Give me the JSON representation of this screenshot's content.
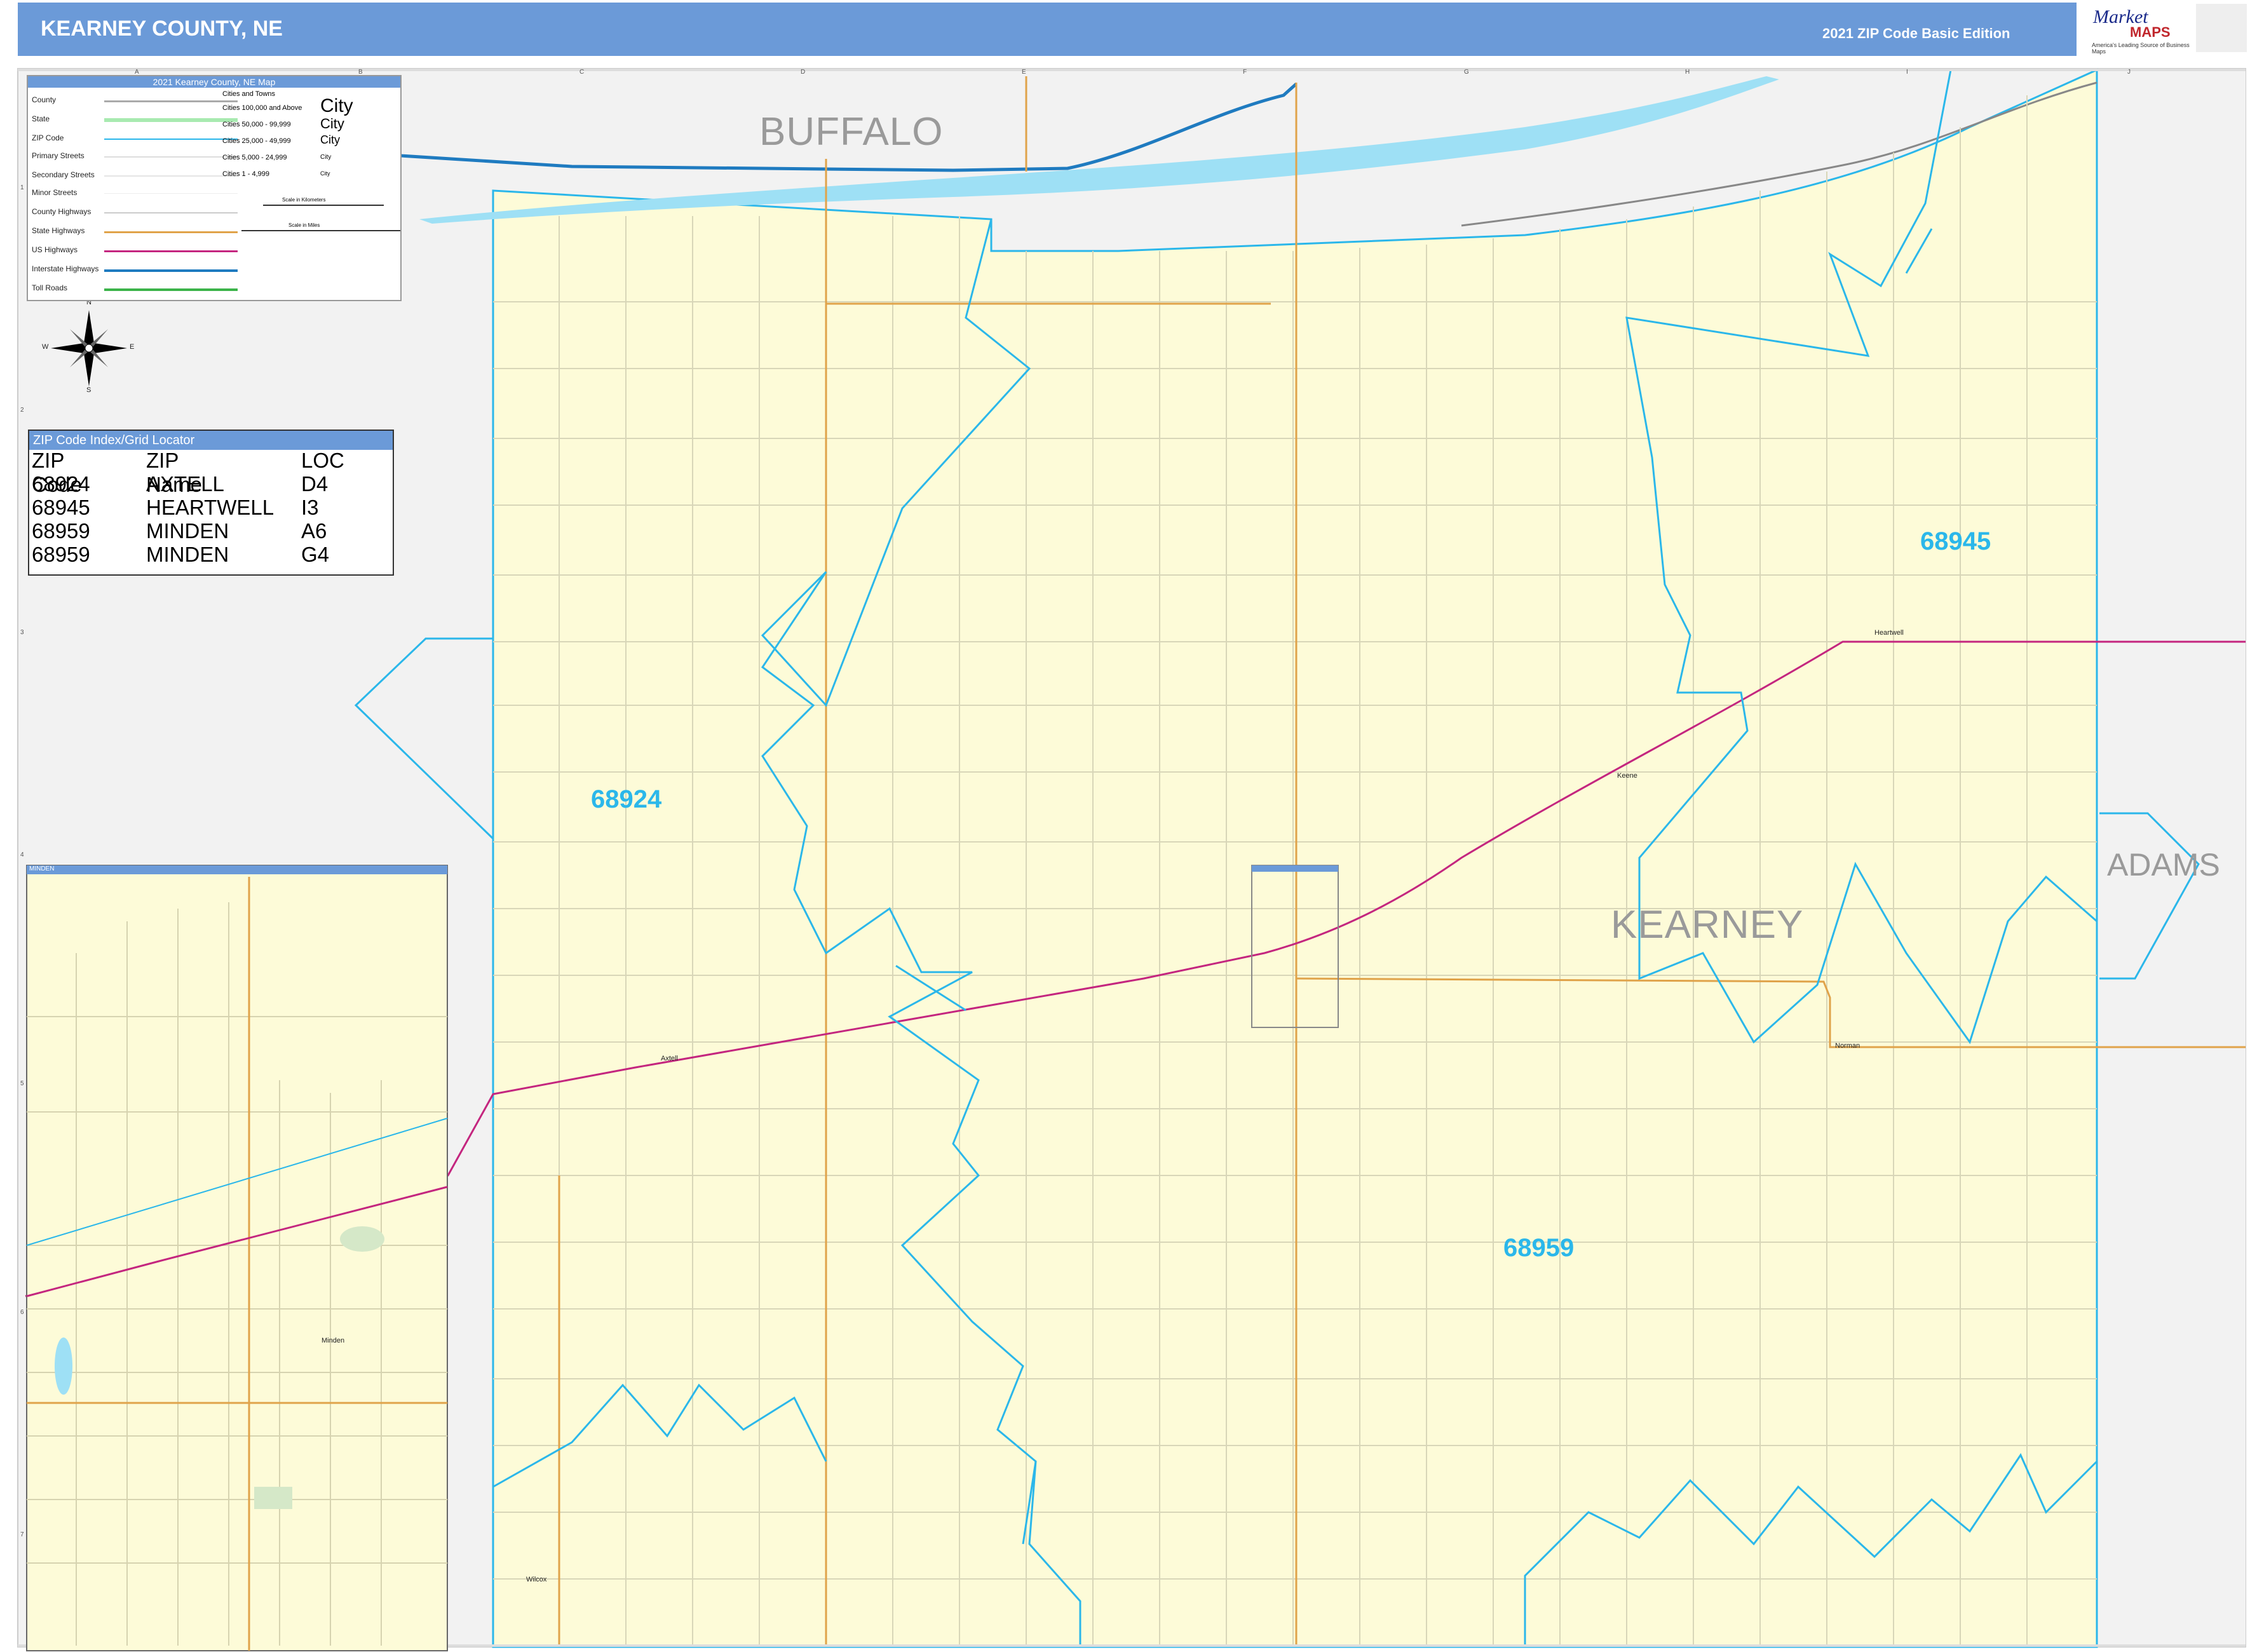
{
  "header": {
    "title": "KEARNEY COUNTY, NE",
    "edition": "2021 ZIP Code Basic Edition",
    "logo_main": "Market",
    "logo_maps": "MAPS",
    "logo_tagline": "America's Leading Source of Business Maps"
  },
  "legend": {
    "title": "2021 Kearney County, NE Map",
    "items": [
      "County",
      "State",
      "ZIP Code",
      "Primary Streets",
      "Secondary Streets",
      "Minor Streets",
      "County Highways",
      "State Highways",
      "US Highways",
      "Interstate Highways",
      "Toll Roads"
    ],
    "cities_header": "Cities and Towns",
    "city_classes": [
      "Cities 100,000 and Above",
      "Cities 50,000 - 99,999",
      "Cities 25,000 - 49,999",
      "Cities 5,000 - 24,999",
      "Cities 1 - 4,999"
    ],
    "city_samples": [
      "City",
      "City",
      "City",
      "City",
      "City"
    ],
    "scale_km": "Scale in Kilometers",
    "scale_mi": "Scale in Miles"
  },
  "zip_index": {
    "title": "ZIP Code Index/Grid Locator",
    "headers": [
      "ZIP Code",
      "ZIP Name",
      "LOC"
    ],
    "rows": [
      [
        "68924",
        "AXTELL",
        "D4"
      ],
      [
        "68945",
        "HEARTWELL",
        "I3"
      ],
      [
        "68959",
        "MINDEN",
        "A6"
      ],
      [
        "68959",
        "MINDEN",
        "G4"
      ]
    ]
  },
  "map": {
    "zip_labels": [
      "68945",
      "68924",
      "68959"
    ],
    "county_label": "KEARNEY",
    "adjacent_counties": [
      "BUFFALO",
      "ADAMS"
    ],
    "places": [
      "Heartwell",
      "Keene",
      "Norman",
      "Axtell",
      "Wilcox",
      "Minden"
    ],
    "inset_title": "MINDEN",
    "col_letters": [
      "A",
      "B",
      "C",
      "D",
      "E",
      "F",
      "G",
      "H",
      "I",
      "J"
    ],
    "row_numbers": [
      "1",
      "2",
      "3",
      "4",
      "5",
      "6",
      "7"
    ],
    "compass": [
      "N",
      "E",
      "S",
      "W"
    ],
    "colors": {
      "county_fill": "#fdfbd8",
      "zip_boundary": "#2bb7ea",
      "us_highway": "#c4267f",
      "interstate": "#1f7bc0",
      "state_highway": "#e0a34a",
      "river": "#9ee0f5",
      "title_bar": "#6b9ad8"
    }
  }
}
